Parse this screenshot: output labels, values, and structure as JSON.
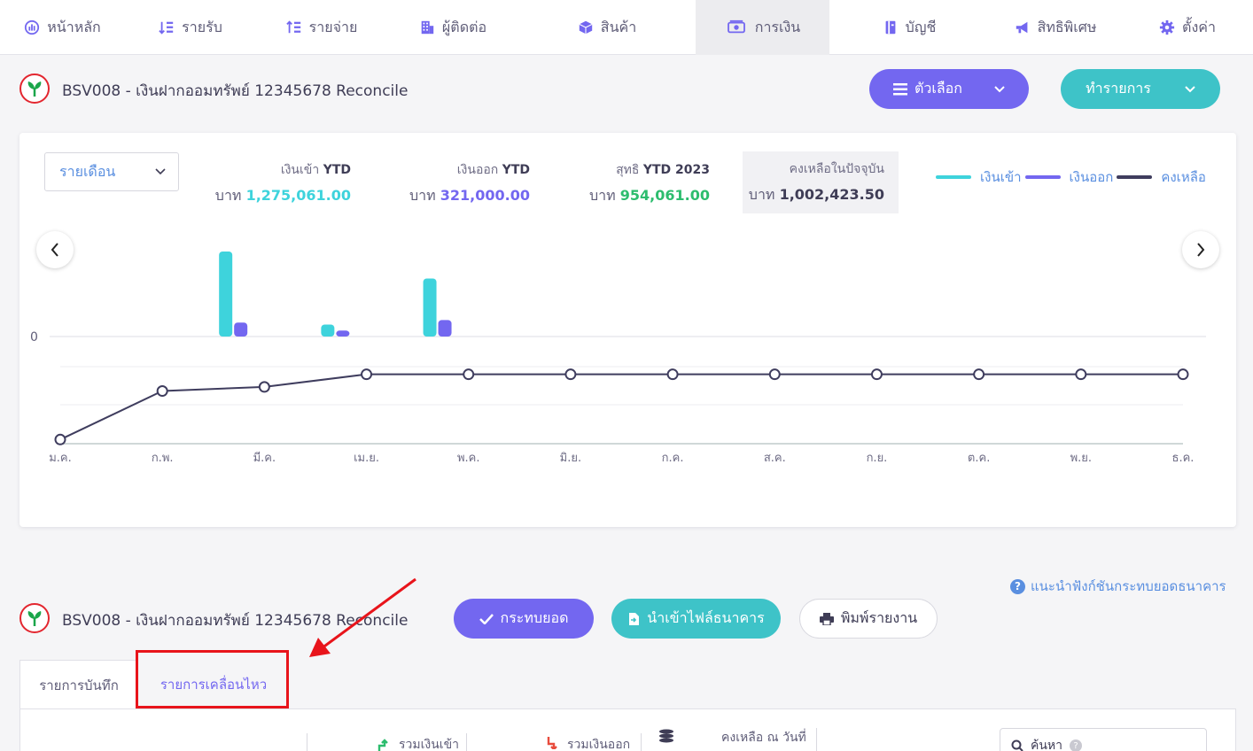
{
  "nav": {
    "items": [
      {
        "label": "หน้าหลัก",
        "icon": "dashboard-gauge-icon"
      },
      {
        "label": "รายรับ",
        "icon": "income-list-icon"
      },
      {
        "label": "รายจ่าย",
        "icon": "expense-list-icon"
      },
      {
        "label": "ผู้ติดต่อ",
        "icon": "building-icon"
      },
      {
        "label": "สินค้า",
        "icon": "box-icon"
      },
      {
        "label": "การเงิน",
        "icon": "money-icon",
        "active": true
      },
      {
        "label": "บัญชี",
        "icon": "ledger-icon"
      },
      {
        "label": "สิทธิพิเศษ",
        "icon": "megaphone-icon"
      },
      {
        "label": "ตั้งค่า",
        "icon": "gear-icon"
      }
    ]
  },
  "header": {
    "title": "BSV008 - เงินฝากออมทรัพย์ 12345678 Reconcile",
    "options_label": "ตัวเลือก",
    "actions_label": "ทำรายการ"
  },
  "summary": {
    "period": "รายเดือน",
    "income": {
      "label": "เงินเข้า",
      "suffix": "YTD",
      "currency": "บาท",
      "value": "1,275,061.00"
    },
    "expense": {
      "label": "เงินออก",
      "suffix": "YTD",
      "currency": "บาท",
      "value": "321,000.00"
    },
    "net": {
      "label": "สุทธิ",
      "suffix": "YTD 2023",
      "currency": "บาท",
      "value": "954,061.00"
    },
    "balance": {
      "label": "คงเหลือในปัจจุบัน",
      "currency": "บาท",
      "value": "1,002,423.50"
    }
  },
  "colors": {
    "income": "#3ed3dc",
    "expense": "#7367f0",
    "balance": "#3f3d5e",
    "net": "#2dbd6e",
    "accent_blue": "#5a8fe0"
  },
  "chart_data": {
    "type": "bar",
    "bar_axis_label": "0",
    "legend": [
      "เงินเข้า",
      "เงินออก",
      "คงเหลือ"
    ],
    "legend_position": "top-right",
    "categories": [
      "ม.ค.",
      "ก.พ.",
      "มี.ค.",
      "เม.ย.",
      "พ.ค.",
      "มิ.ย.",
      "ก.ค.",
      "ส.ค.",
      "ก.ย.",
      "ต.ค.",
      "พ.ย.",
      "ธ.ค."
    ],
    "series": [
      {
        "name": "เงินเข้า",
        "values": [
          0,
          850000,
          120000,
          580000,
          0,
          0,
          0,
          0,
          0,
          0,
          0,
          0
        ]
      },
      {
        "name": "เงินออก",
        "values": [
          0,
          140000,
          60000,
          165000,
          0,
          0,
          0,
          0,
          0,
          0,
          0,
          0
        ]
      },
      {
        "name": "คงเหลือ",
        "values": [
          48000,
          758000,
          818000,
          1002423.5,
          1002423.5,
          1002423.5,
          1002423.5,
          1002423.5,
          1002423.5,
          1002423.5,
          1002423.5,
          1002423.5
        ]
      }
    ],
    "bar_ylim": [
      0,
      850000
    ],
    "line_ylim": [
      0,
      1400000
    ]
  },
  "reconcile": {
    "title": "BSV008 - เงินฝากออมทรัพย์ 12345678 Reconcile",
    "help_text": "แนะนำฟังก์ชันกระทบยอดธนาคาร",
    "match_label": "กระทบยอด",
    "import_label": "นำเข้าไฟล์ธนาคาร",
    "print_label": "พิมพ์รายงาน",
    "tabs": [
      "รายการบันทึก",
      "รายการเคลื่อนไหว"
    ],
    "totals": {
      "income_label": "รวมเงินเข้า",
      "expense_label": "รวมเงินออก",
      "balance_label": "คงเหลือ ณ วันที่"
    },
    "search_label": "ค้นหา",
    "search_help": "?"
  }
}
